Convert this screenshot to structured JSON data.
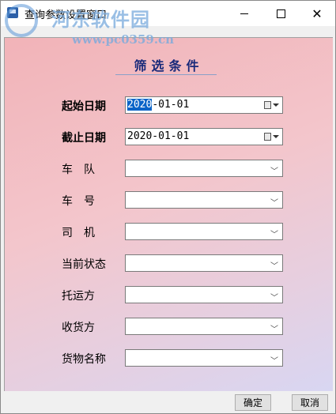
{
  "window": {
    "title": "查询参数设置窗口"
  },
  "watermark": {
    "name": "河东软件园",
    "url": "www.pc0359.cn"
  },
  "form": {
    "heading": "筛选条件",
    "fields": [
      {
        "label": "起始日期",
        "value_selected": "2020",
        "value_rest": "-01-01"
      },
      {
        "label": "截止日期",
        "value": "2020-01-01"
      },
      {
        "label": "车　队",
        "value": ""
      },
      {
        "label": "车　号",
        "value": ""
      },
      {
        "label": "司　机",
        "value": ""
      },
      {
        "label": "当前状态",
        "value": ""
      },
      {
        "label": "托运方",
        "value": ""
      },
      {
        "label": "收货方",
        "value": ""
      },
      {
        "label": "货物名称",
        "value": ""
      }
    ]
  },
  "buttons": {
    "ok": "确定",
    "cancel": "取消"
  }
}
